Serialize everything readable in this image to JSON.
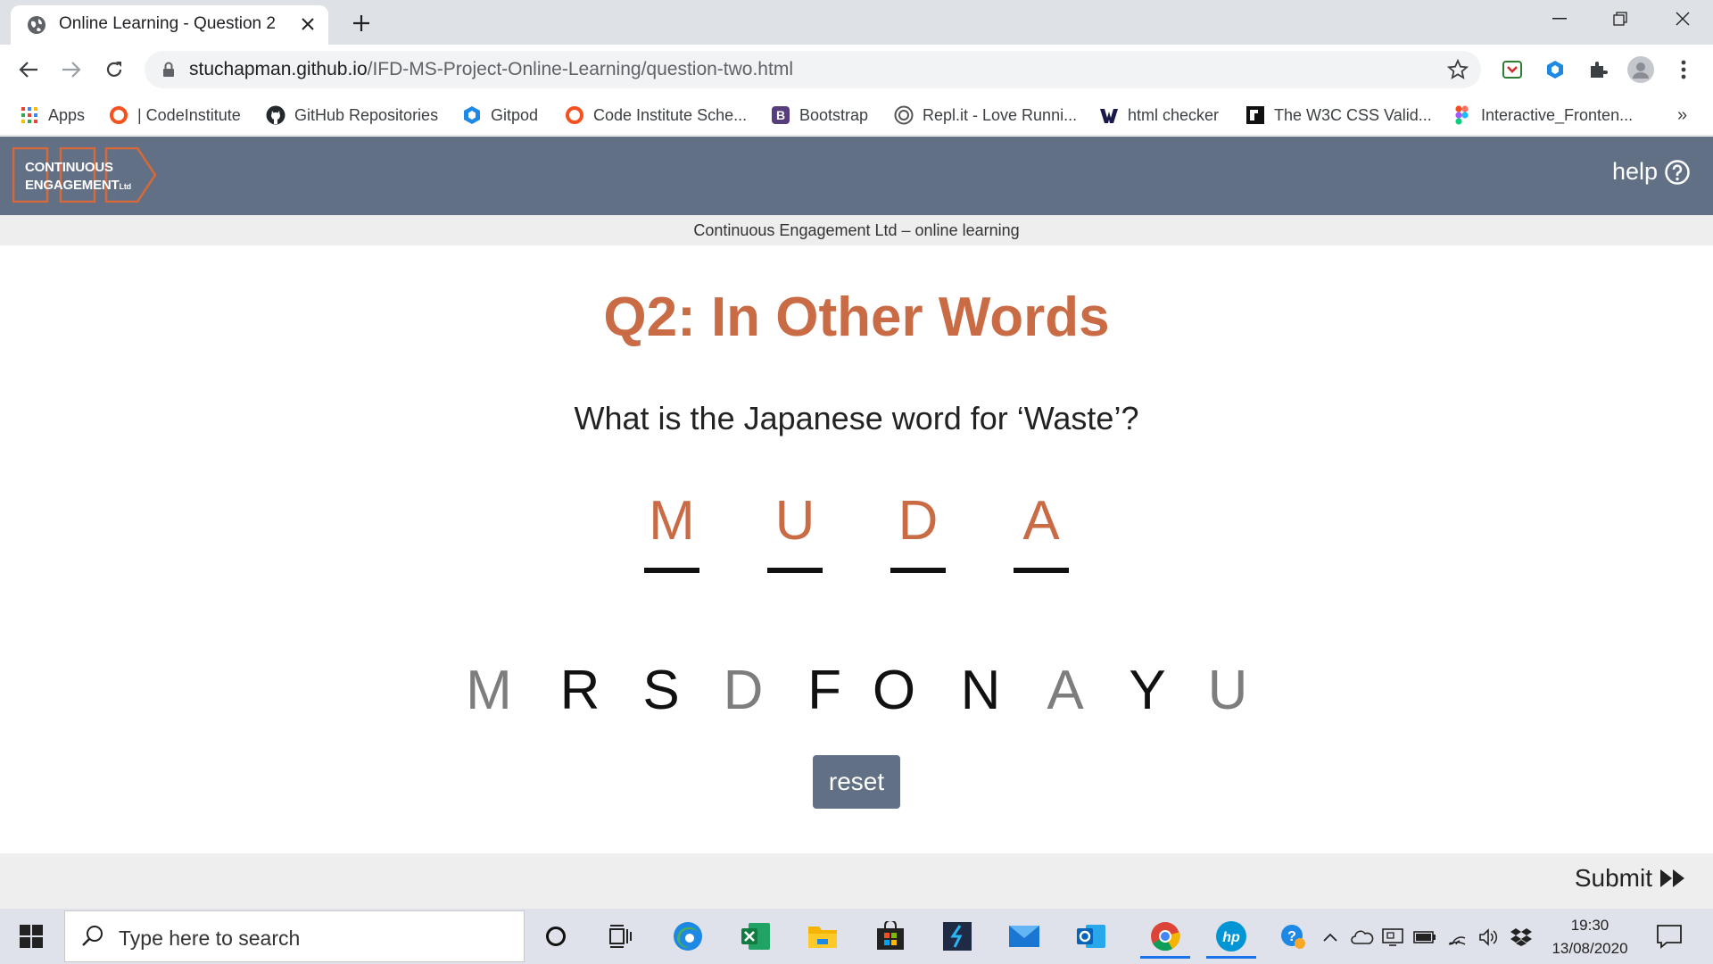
{
  "browser": {
    "tab_title": "Online Learning - Question 2",
    "url_domain": "stuchapman.github.io",
    "url_path": "/IFD-MS-Project-Online-Learning/question-two.html",
    "bookmarks": [
      {
        "label": "Apps",
        "icon": "apps-grid-icon"
      },
      {
        "label": "| CodeInstitute",
        "icon": "codeinstitute-icon"
      },
      {
        "label": "GitHub Repositories",
        "icon": "github-icon"
      },
      {
        "label": "Gitpod",
        "icon": "gitpod-icon"
      },
      {
        "label": "Code Institute Sche...",
        "icon": "codeinstitute-icon"
      },
      {
        "label": "Bootstrap",
        "icon": "bootstrap-icon"
      },
      {
        "label": "Repl.it - Love Runni...",
        "icon": "replit-icon"
      },
      {
        "label": "html checker",
        "icon": "w3c-icon"
      },
      {
        "label": "The W3C CSS Valid...",
        "icon": "w3c-css-icon"
      },
      {
        "label": "Interactive_Fronten...",
        "icon": "figma-icon"
      }
    ],
    "overflow_label": "»"
  },
  "site": {
    "logo_line1": "CONTINUOUS",
    "logo_line2": "ENGAGEMENT",
    "logo_suffix": "Ltd",
    "help_label": "help",
    "subtitle": "Continuous Engagement Ltd – online learning"
  },
  "question": {
    "title": "Q2: In Other Words",
    "text": "What is the Japanese word for ‘Waste’?",
    "answer_slots": [
      "M",
      "U",
      "D",
      "A"
    ],
    "letter_choices": [
      {
        "letter": "M",
        "used": true
      },
      {
        "letter": "R",
        "used": false
      },
      {
        "letter": "S",
        "used": false
      },
      {
        "letter": "D",
        "used": true
      },
      {
        "letter": "F",
        "used": false
      },
      {
        "letter": "O",
        "used": false
      },
      {
        "letter": "N",
        "used": false
      },
      {
        "letter": "A",
        "used": true
      },
      {
        "letter": "Y",
        "used": false
      },
      {
        "letter": "U",
        "used": true
      }
    ],
    "reset_label": "reset",
    "submit_label": "Submit"
  },
  "taskbar": {
    "search_placeholder": "Type here to search",
    "time": "19:30",
    "date": "13/08/2020"
  },
  "colors": {
    "accent": "#c96c46",
    "header": "#627085",
    "used_letter": "#7d7d7d"
  }
}
